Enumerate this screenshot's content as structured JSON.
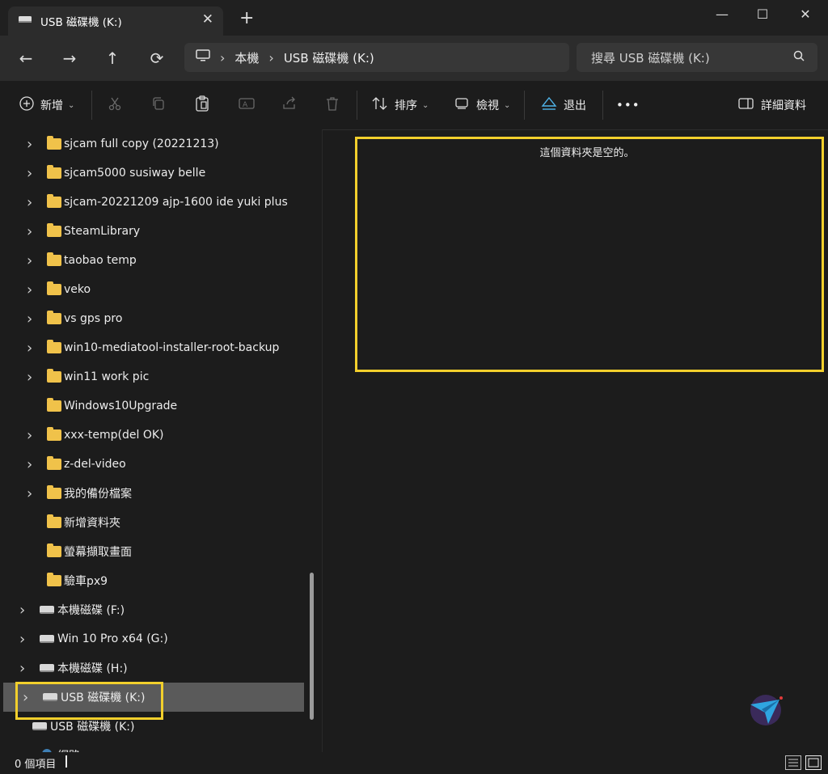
{
  "tab": {
    "title": "USB 磁碟機 (K:)",
    "close": "✕",
    "new_tab": "+"
  },
  "window": {
    "minimize": "—",
    "maximize": "☐",
    "close": "✕"
  },
  "nav": {
    "back": "←",
    "forward": "→",
    "up": "↑",
    "refresh": "⟳"
  },
  "address": {
    "crumbs": [
      "本機",
      "USB 磁碟機 (K:)"
    ],
    "sep": "›"
  },
  "search": {
    "placeholder": "搜尋 USB 磁碟機 (K:)"
  },
  "toolbar": {
    "new_label": "新增",
    "sort_label": "排序",
    "view_label": "檢視",
    "eject_label": "退出",
    "more": "•••",
    "details_label": "詳細資料"
  },
  "sidebar": {
    "items": [
      {
        "label": "sjcam full copy (20221213)",
        "expandable": true,
        "type": "folder"
      },
      {
        "label": "sjcam5000 susiway belle",
        "expandable": true,
        "type": "folder"
      },
      {
        "label": "sjcam-20221209 ajp-1600 ide yuki plus",
        "expandable": true,
        "type": "folder"
      },
      {
        "label": "SteamLibrary",
        "expandable": true,
        "type": "folder"
      },
      {
        "label": "taobao temp",
        "expandable": true,
        "type": "folder"
      },
      {
        "label": "veko",
        "expandable": true,
        "type": "folder"
      },
      {
        "label": "vs gps pro",
        "expandable": true,
        "type": "folder"
      },
      {
        "label": "win10-mediatool-installer-root-backup",
        "expandable": true,
        "type": "folder"
      },
      {
        "label": "win11 work pic",
        "expandable": true,
        "type": "folder"
      },
      {
        "label": "Windows10Upgrade",
        "expandable": false,
        "type": "folder"
      },
      {
        "label": "xxx-temp(del OK)",
        "expandable": true,
        "type": "folder"
      },
      {
        "label": "z-del-video",
        "expandable": true,
        "type": "folder"
      },
      {
        "label": "我的備份檔案",
        "expandable": true,
        "type": "folder"
      },
      {
        "label": "新增資料夾",
        "expandable": false,
        "type": "folder"
      },
      {
        "label": "螢幕擷取畫面",
        "expandable": false,
        "type": "folder"
      },
      {
        "label": "驗車px9",
        "expandable": false,
        "type": "folder"
      },
      {
        "label": "本機磁碟 (F:)",
        "expandable": true,
        "type": "drive"
      },
      {
        "label": "Win 10 Pro x64 (G:)",
        "expandable": true,
        "type": "drive"
      },
      {
        "label": "本機磁碟 (H:)",
        "expandable": true,
        "type": "drive"
      },
      {
        "label": "USB 磁碟機 (K:)",
        "expandable": true,
        "type": "drive",
        "selected": true
      },
      {
        "label": "USB 磁碟機 (K:)",
        "expandable": false,
        "type": "drive"
      },
      {
        "label": "網路",
        "expandable": true,
        "type": "network"
      }
    ]
  },
  "main": {
    "empty_message": "這個資料夾是空的。"
  },
  "status": {
    "item_count": "0 個項目"
  },
  "colors": {
    "highlight": "#f2cf2c",
    "folder": "#f0c24a",
    "selected": "#5a5a5a"
  }
}
